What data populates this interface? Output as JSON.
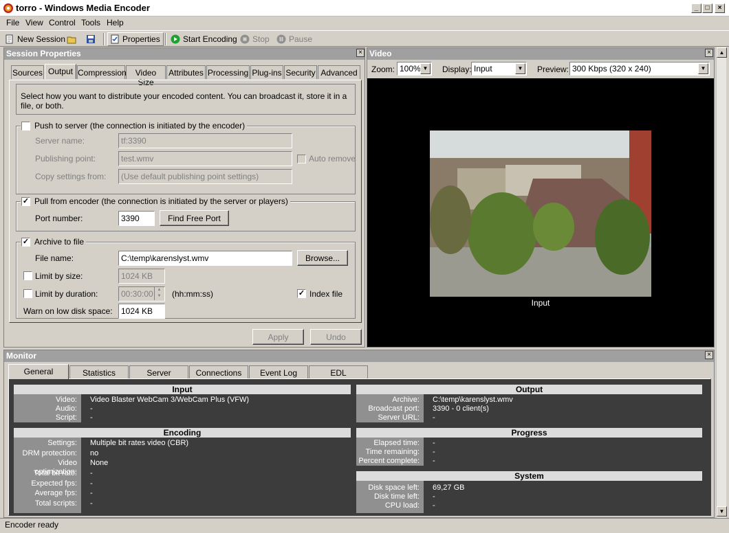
{
  "window": {
    "title": "torro - Windows Media Encoder"
  },
  "menu": [
    "File",
    "View",
    "Control",
    "Tools",
    "Help"
  ],
  "toolbar": {
    "new_session": "New Session",
    "properties": "Properties",
    "start_encoding": "Start Encoding",
    "stop": "Stop",
    "pause": "Pause"
  },
  "session": {
    "title": "Session Properties",
    "tabs": [
      "Sources",
      "Output",
      "Compression",
      "Video Size",
      "Attributes",
      "Processing",
      "Plug-ins",
      "Security",
      "Advanced"
    ],
    "description": "Select how you want to distribute your encoded content. You can broadcast it, store it in a file, or both.",
    "push": {
      "title": "Push to server (the connection is initiated by the encoder)",
      "server_label": "Server name:",
      "server_value": "tf:3390",
      "point_label": "Publishing point:",
      "point_value": "test.wmv",
      "auto_remove": "Auto remove",
      "copy_label": "Copy settings from:",
      "copy_value": "(Use default publishing point settings)"
    },
    "pull": {
      "title": "Pull from encoder (the connection is initiated by the server or players)",
      "port_label": "Port number:",
      "port_value": "3390",
      "find_port": "Find Free Port"
    },
    "archive": {
      "title": "Archive to file",
      "file_label": "File name:",
      "file_value": "C:\\temp\\karenslyst.wmv",
      "browse": "Browse...",
      "limit_size": "Limit by size:",
      "limit_size_value": "1024 KB",
      "limit_duration": "Limit by duration:",
      "limit_duration_value": "00:30:00",
      "duration_hint": "(hh:mm:ss)",
      "index_file": "Index file",
      "warn_label": "Warn on low disk space:",
      "warn_value": "1024 KB"
    },
    "apply": "Apply",
    "undo": "Undo"
  },
  "video": {
    "title": "Video",
    "zoom_label": "Zoom:",
    "zoom_value": "100%",
    "display_label": "Display:",
    "display_value": "Input",
    "preview_label": "Preview:",
    "preview_value": "300 Kbps (320 x 240)",
    "caption": "Input"
  },
  "monitor": {
    "title": "Monitor",
    "tabs": [
      "General",
      "Statistics",
      "Server",
      "Connections",
      "Event Log",
      "EDL"
    ],
    "input": {
      "title": "Input",
      "rows": [
        [
          "Video:",
          "Video Blaster WebCam 3/WebCam Plus (VFW)"
        ],
        [
          "Audio:",
          "-"
        ],
        [
          "Script:",
          "-"
        ]
      ]
    },
    "output": {
      "title": "Output",
      "rows": [
        [
          "Archive:",
          "C:\\temp\\karenslyst.wmv"
        ],
        [
          "Broadcast port:",
          "3390 - 0 client(s)"
        ],
        [
          "Server URL:",
          "-"
        ]
      ]
    },
    "encoding": {
      "title": "Encoding",
      "rows": [
        [
          "Settings:",
          "Multiple bit rates video (CBR)"
        ],
        [
          "DRM protection:",
          "no"
        ],
        [
          "Video optimization:",
          "None"
        ],
        [
          "Total bit rate:",
          "-"
        ],
        [
          "Expected fps:",
          "-"
        ],
        [
          "Average fps:",
          "-"
        ],
        [
          "Total scripts:",
          "-"
        ]
      ]
    },
    "progress": {
      "title": "Progress",
      "rows": [
        [
          "Elapsed time:",
          "-"
        ],
        [
          "Time remaining:",
          "-"
        ],
        [
          "Percent complete:",
          "-"
        ]
      ]
    },
    "system": {
      "title": "System",
      "rows": [
        [
          "Disk space left:",
          "69,27 GB"
        ],
        [
          "Disk time left:",
          "-"
        ],
        [
          "CPU load:",
          "-"
        ]
      ]
    }
  },
  "status": "Encoder ready"
}
